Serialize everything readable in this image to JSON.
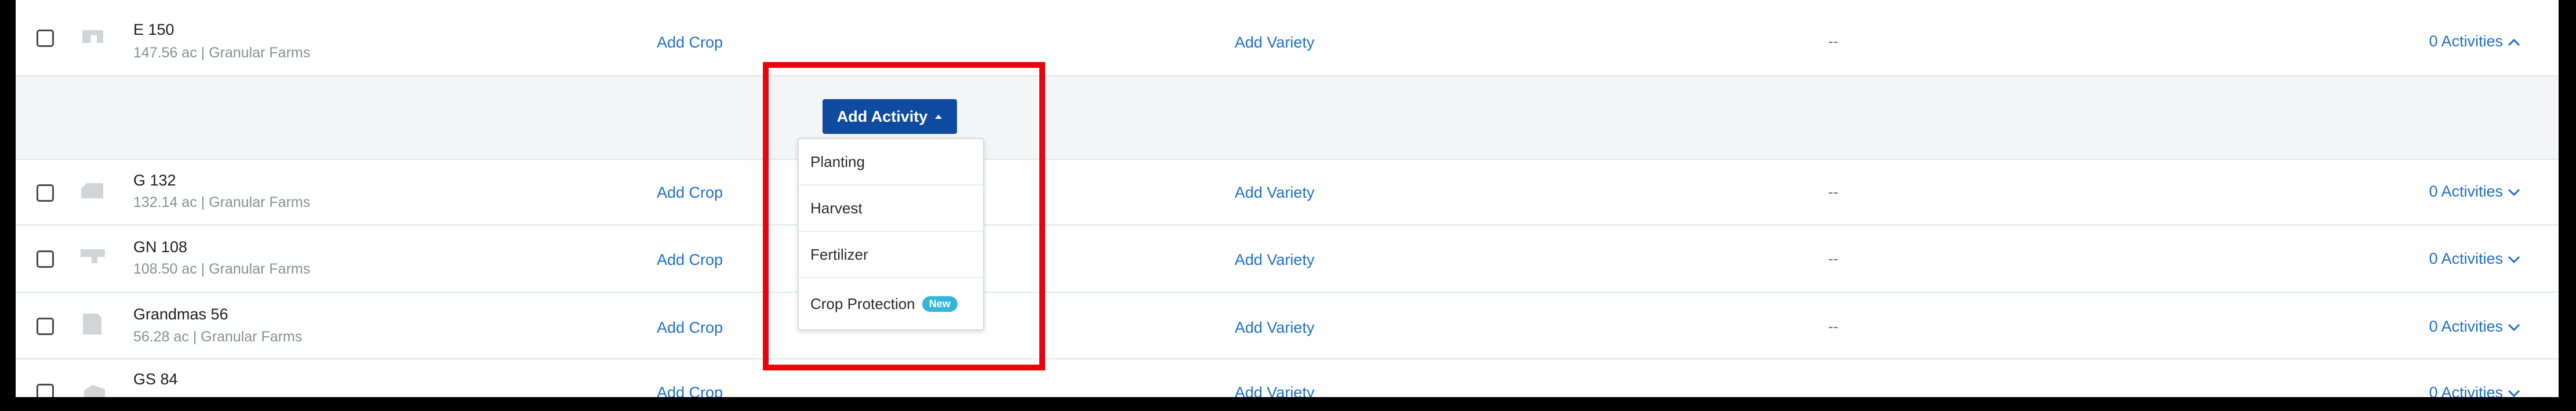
{
  "fields": [
    {
      "name": "E 150",
      "meta": "147.56 ac | Granular Farms",
      "crop": "Add Crop",
      "variety": "Add Variety",
      "value": "--",
      "activities": "0 Activities",
      "expanded": true
    },
    {
      "name": "G 132",
      "meta": "132.14 ac | Granular Farms",
      "crop": "Add Crop",
      "variety": "Add Variety",
      "value": "--",
      "activities": "0 Activities",
      "expanded": false
    },
    {
      "name": "GN 108",
      "meta": "108.50 ac | Granular Farms",
      "crop": "Add Crop",
      "variety": "Add Variety",
      "value": "--",
      "activities": "0 Activities",
      "expanded": false
    },
    {
      "name": "Grandmas 56",
      "meta": "56.28 ac | Granular Farms",
      "crop": "Add Crop",
      "variety": "Add Variety",
      "value": "--",
      "activities": "0 Activities",
      "expanded": false
    },
    {
      "name": "GS 84",
      "meta": "",
      "crop": "Add Crop",
      "variety": "Add Variety",
      "value": "",
      "activities": "0 Activities",
      "expanded": false
    }
  ],
  "add_activity": {
    "label": "Add Activity",
    "menu": [
      {
        "label": "Planting"
      },
      {
        "label": "Harvest"
      },
      {
        "label": "Fertilizer"
      },
      {
        "label": "Crop Protection",
        "badge": "New"
      }
    ]
  },
  "colors": {
    "link": "#1f6fc9",
    "button": "#0f4ba0",
    "highlight": "#e8050d",
    "badge": "#35b5d8"
  }
}
